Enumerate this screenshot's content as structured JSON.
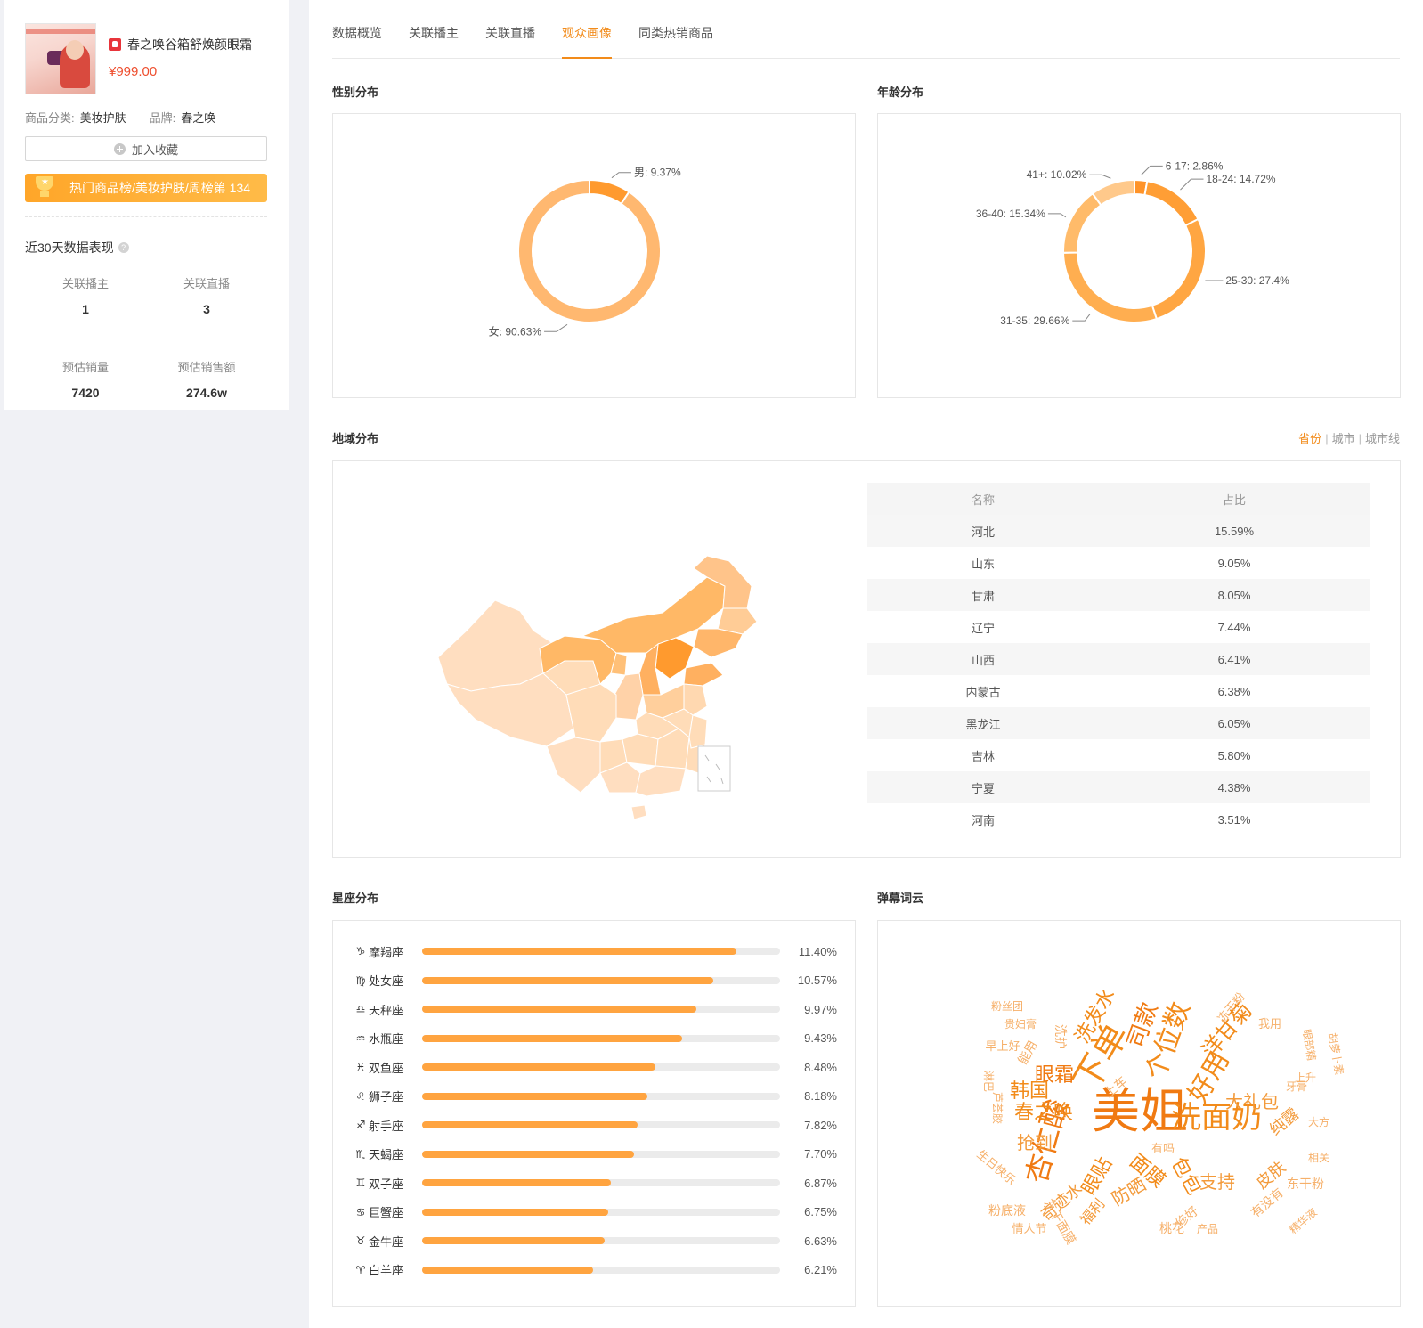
{
  "product": {
    "title": "春之唤谷箱舒焕颜眼霜",
    "price": "¥999.00",
    "category_label": "商品分类:",
    "category": "美妆护肤",
    "brand_label": "品牌:",
    "brand": "春之唤",
    "fav_label": "加入收藏",
    "rank_text": "热门商品榜/美妆护肤/周榜第 134"
  },
  "perf": {
    "title": "近30天数据表现",
    "stats": [
      {
        "label": "关联播主",
        "value": "1"
      },
      {
        "label": "关联直播",
        "value": "3"
      },
      {
        "label": "预估销量",
        "value": "7420"
      },
      {
        "label": "预估销售额",
        "value": "274.6w"
      }
    ]
  },
  "tabs": [
    "数据概览",
    "关联播主",
    "关联直播",
    "观众画像",
    "同类热销商品"
  ],
  "active_tab": 3,
  "sections": {
    "gender": "性别分布",
    "age": "年龄分布",
    "region": "地域分布",
    "zodiac": "星座分布",
    "wordcloud": "弹幕词云"
  },
  "region_tabs": [
    "省份",
    "城市",
    "城市线"
  ],
  "gender_chart": {
    "type": "pie",
    "slices": [
      {
        "label": "男",
        "value": 9.37,
        "text": "男: 9.37%",
        "color": "#ff9a2e"
      },
      {
        "label": "女",
        "value": 90.63,
        "text": "女: 90.63%",
        "color": "#ffb870"
      }
    ]
  },
  "age_chart": {
    "type": "pie",
    "slices": [
      {
        "label": "6-17",
        "value": 2.86,
        "text": "6-17: 2.86%",
        "color": "#ff9328"
      },
      {
        "label": "18-24",
        "value": 14.72,
        "text": "18-24: 14.72%",
        "color": "#ff9e35"
      },
      {
        "label": "25-30",
        "value": 27.4,
        "text": "25-30: 27.4%",
        "color": "#ffa642"
      },
      {
        "label": "31-35",
        "value": 29.66,
        "text": "31-35: 29.66%",
        "color": "#ffae50"
      },
      {
        "label": "36-40",
        "value": 15.34,
        "text": "36-40: 15.34%",
        "color": "#ffbb6a"
      },
      {
        "label": "41+",
        "value": 10.02,
        "text": "41+: 10.02%",
        "color": "#ffc98b"
      }
    ]
  },
  "region_table": {
    "headers": [
      "名称",
      "占比"
    ],
    "rows": [
      [
        "河北",
        "15.59%"
      ],
      [
        "山东",
        "9.05%"
      ],
      [
        "甘肃",
        "8.05%"
      ],
      [
        "辽宁",
        "7.44%"
      ],
      [
        "山西",
        "6.41%"
      ],
      [
        "内蒙古",
        "6.38%"
      ],
      [
        "黑龙江",
        "6.05%"
      ],
      [
        "吉林",
        "5.80%"
      ],
      [
        "宁夏",
        "4.38%"
      ],
      [
        "河南",
        "3.51%"
      ]
    ]
  },
  "zodiac": [
    {
      "icon": "♑",
      "name": "摩羯座",
      "pct": 11.4,
      "text": "11.40%"
    },
    {
      "icon": "♍",
      "name": "处女座",
      "pct": 10.57,
      "text": "10.57%"
    },
    {
      "icon": "♎",
      "name": "天秤座",
      "pct": 9.97,
      "text": "9.97%"
    },
    {
      "icon": "♒",
      "name": "水瓶座",
      "pct": 9.43,
      "text": "9.43%"
    },
    {
      "icon": "♓",
      "name": "双鱼座",
      "pct": 8.48,
      "text": "8.48%"
    },
    {
      "icon": "♌",
      "name": "狮子座",
      "pct": 8.18,
      "text": "8.18%"
    },
    {
      "icon": "♐",
      "name": "射手座",
      "pct": 7.82,
      "text": "7.82%"
    },
    {
      "icon": "♏",
      "name": "天蝎座",
      "pct": 7.7,
      "text": "7.70%"
    },
    {
      "icon": "♊",
      "name": "双子座",
      "pct": 6.87,
      "text": "6.87%"
    },
    {
      "icon": "♋",
      "name": "巨蟹座",
      "pct": 6.75,
      "text": "6.75%"
    },
    {
      "icon": "♉",
      "name": "金牛座",
      "pct": 6.63,
      "text": "6.63%"
    },
    {
      "icon": "♈",
      "name": "白羊座",
      "pct": 6.21,
      "text": "6.21%"
    }
  ],
  "colors": {
    "accent": "#f28b1a",
    "price": "#ee4d2d",
    "bar": "#ffa440"
  },
  "wordcloud": [
    "美姐",
    "下单",
    "洗面奶",
    "杏仁酸",
    "好用",
    "个位数",
    "司款",
    "洋甘菊",
    "洗发水",
    "眼霜",
    "韩国",
    "春之唤",
    "抢到",
    "面膜",
    "眼贴",
    "防晒",
    "包包",
    "支持",
    "大礼包",
    "纯露",
    "皮肤",
    "奇迹水",
    "福利",
    "东干面膜",
    "东干粉",
    "粉底液",
    "桃花",
    "修好",
    "产品",
    "有没有",
    "上车",
    "早上好",
    "生日快乐",
    "情人节",
    "有吗",
    "能用",
    "洗护",
    "冻干粉",
    "我用",
    "相关",
    "大方",
    "上升",
    "精华液",
    "牙膏",
    "胡萝卜素",
    "眼部精",
    "粉丝团",
    "贵妇膏",
    "芦荟胶",
    "淋巴"
  ]
}
